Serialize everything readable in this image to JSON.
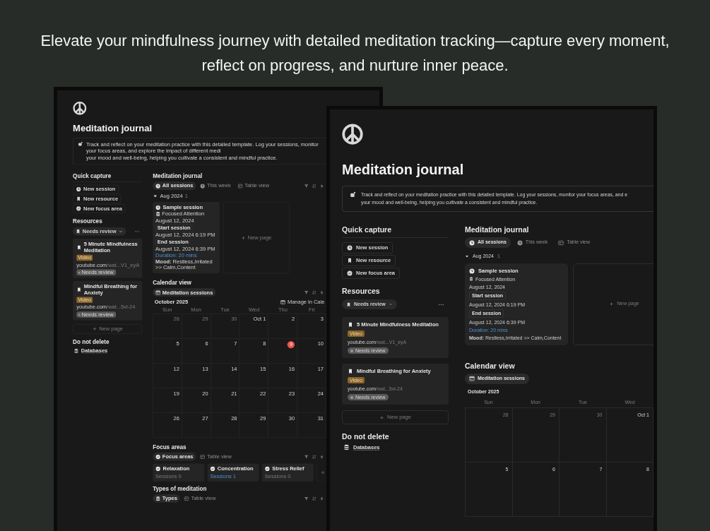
{
  "headline": "Elevate your mindfulness journey with detailed meditation tracking—capture every moment, reflect on progress, and nurture inner peace.",
  "screens": [
    {
      "toolbar_icons": true,
      "title": "Meditation journal",
      "callout_lines": [
        "Track and reflect on your meditation practice with this detailed template. Log your sessions, monitor your focus areas, and explore the impact of different medi",
        "your mood and well-being, helping you cultivate a consistent and mindful practice."
      ],
      "quick_capture": {
        "heading": "Quick capture",
        "buttons": [
          {
            "kind": "session",
            "label": "New session"
          },
          {
            "kind": "resource",
            "label": "New resource"
          },
          {
            "kind": "focus_area",
            "label": "New focus area"
          }
        ]
      },
      "resources": {
        "heading": "Resources",
        "filter": "Needs review",
        "cards": [
          {
            "title": "5 Minute Mindfulness Meditation",
            "tag": "Video",
            "url_host": "youtube.com",
            "url_path": "/wat...V1_eyA",
            "status": "Needs review"
          },
          {
            "title": "Mindful Breathing for Anxiety",
            "tag": "Video",
            "url_host": "youtube.com",
            "url_path": "/wat...5vl-24",
            "status": "Needs review"
          }
        ],
        "new_page": "New page"
      },
      "do_not_delete": {
        "heading": "Do not delete",
        "items": [
          "Databases"
        ]
      },
      "journal": {
        "heading": "Meditation journal",
        "tabs": [
          {
            "kind": "sessions",
            "label": "All sessions",
            "selected": true
          },
          {
            "kind": "sessions",
            "label": "This week",
            "selected": false
          },
          {
            "kind": "table",
            "label": "Table view",
            "selected": false
          }
        ],
        "group": {
          "label": "Aug 2024",
          "count": "1",
          "expanded": true
        },
        "card": {
          "title": "Sample session",
          "type": "Focused Attention",
          "date": "August 12, 2024",
          "start_label": "Start session",
          "start": "August 12, 2024 6:19 PM",
          "end_label": "End session",
          "end": "August 12, 2024 6:39 PM",
          "duration": "Duration: 20 mins",
          "mood": "**Mood:** Restless,Irritated >> Calm,Content"
        },
        "new_page": "New page"
      },
      "calendar": {
        "heading": "Calendar view",
        "tabs": [
          {
            "kind": "calendar",
            "label": "Meditation sessions",
            "selected": true
          }
        ],
        "month": "October 2025",
        "manage": "Manage in Cale",
        "weekdays": [
          "Sun",
          "Mon",
          "Tue",
          "Wed",
          "Thu",
          "Fri"
        ],
        "weeks": [
          [
            {
              "label": "28",
              "muted": true,
              "today": false
            },
            {
              "label": "29",
              "muted": true,
              "today": false
            },
            {
              "label": "30",
              "muted": true,
              "today": false
            },
            {
              "label": "Oct 1",
              "muted": false,
              "today": false
            },
            {
              "label": "2",
              "muted": false,
              "today": false
            },
            {
              "label": "3",
              "muted": false,
              "today": false
            }
          ],
          [
            {
              "label": "5",
              "muted": false,
              "today": false
            },
            {
              "label": "6",
              "muted": false,
              "today": false
            },
            {
              "label": "7",
              "muted": false,
              "today": false
            },
            {
              "label": "8",
              "muted": false,
              "today": false
            },
            {
              "label": "9",
              "muted": false,
              "today": true
            },
            {
              "label": "10",
              "muted": false,
              "today": false
            }
          ],
          [
            {
              "label": "12",
              "muted": false,
              "today": false
            },
            {
              "label": "13",
              "muted": false,
              "today": false
            },
            {
              "label": "14",
              "muted": false,
              "today": false
            },
            {
              "label": "15",
              "muted": false,
              "today": false
            },
            {
              "label": "16",
              "muted": false,
              "today": false
            },
            {
              "label": "17",
              "muted": false,
              "today": false
            }
          ],
          [
            {
              "label": "19",
              "muted": false,
              "today": false
            },
            {
              "label": "20",
              "muted": false,
              "today": false
            },
            {
              "label": "21",
              "muted": false,
              "today": false
            },
            {
              "label": "22",
              "muted": false,
              "today": false
            },
            {
              "label": "23",
              "muted": false,
              "today": false
            },
            {
              "label": "24",
              "muted": false,
              "today": false
            }
          ],
          [
            {
              "label": "26",
              "muted": false,
              "today": false
            },
            {
              "label": "27",
              "muted": false,
              "today": false
            },
            {
              "label": "28",
              "muted": false,
              "today": false
            },
            {
              "label": "29",
              "muted": false,
              "today": false
            },
            {
              "label": "30",
              "muted": false,
              "today": false
            },
            {
              "label": "31",
              "muted": false,
              "today": false
            }
          ]
        ]
      },
      "focus_areas": {
        "heading": "Focus areas",
        "tabs": [
          {
            "kind": "focus",
            "label": "Focus areas",
            "selected": true
          },
          {
            "kind": "table",
            "label": "Table view",
            "selected": false
          }
        ],
        "cards": [
          {
            "title": "Relaxation",
            "sessions": "Sessions 0",
            "linked": false
          },
          {
            "title": "Concentration",
            "sessions": "Sessions 1",
            "linked": true
          },
          {
            "title": "Stress Relief",
            "sessions": "Sessions 0",
            "linked": false
          }
        ]
      },
      "types": {
        "heading": "Types of meditation",
        "tabs": [
          {
            "kind": "types",
            "label": "Types",
            "selected": true
          },
          {
            "kind": "table",
            "label": "Table view",
            "selected": false
          }
        ]
      }
    },
    {
      "title": "Meditation journal",
      "callout_lines": [
        "Track and reflect on your meditation practice with this detailed template. Log your sessions, monitor your focus areas, and e",
        "your mood and well-being, helping you cultivate a consistent and mindful practice."
      ],
      "quick_capture": {
        "heading": "Quick capture",
        "buttons": [
          {
            "kind": "session",
            "label": "New session"
          },
          {
            "kind": "resource",
            "label": "New resource"
          },
          {
            "kind": "focus_area",
            "label": "New focus area"
          }
        ]
      },
      "resources": {
        "heading": "Resources",
        "filter": "Needs review",
        "cards": [
          {
            "title": "5 Minute Mindfulness Meditation",
            "tag": "Video",
            "url_host": "youtube.com",
            "url_path": "/wat...V1_eyA",
            "status": "Needs review"
          },
          {
            "title": "Mindful Breathing for Anxiety",
            "tag": "Video",
            "url_host": "youtube.com",
            "url_path": "/wat...5vl-24",
            "status": "Needs review"
          }
        ],
        "new_page": "New page"
      },
      "do_not_delete": {
        "heading": "Do not delete",
        "items": [
          "Databases"
        ]
      },
      "journal": {
        "heading": "Meditation journal",
        "tabs": [
          {
            "kind": "sessions",
            "label": "All sessions",
            "selected": true
          },
          {
            "kind": "sessions",
            "label": "This week",
            "selected": false
          },
          {
            "kind": "table",
            "label": "Table view",
            "selected": false
          }
        ],
        "group": {
          "label": "Aug 2024",
          "count": "1",
          "expanded": true
        },
        "card": {
          "title": "Sample session",
          "type": "Focused Attention",
          "date": "August 12, 2024",
          "start_label": "Start session",
          "start": "August 12, 2024 6:19 PM",
          "end_label": "End session",
          "end": "August 12, 2024 6:39 PM",
          "duration": "Duration: 20 mins",
          "mood": "**Mood:** Restless,Irritated >> Calm,Content"
        },
        "new_page": "New page"
      },
      "calendar": {
        "heading": "Calendar view",
        "tabs": [
          {
            "kind": "calendar",
            "label": "Meditation sessions",
            "selected": true
          }
        ],
        "month": "October 2025",
        "weekdays": [
          "Sun",
          "Mon",
          "Tue",
          "Wed"
        ],
        "weeks": [
          [
            {
              "label": "28",
              "muted": true,
              "today": false
            },
            {
              "label": "29",
              "muted": true,
              "today": false
            },
            {
              "label": "30",
              "muted": true,
              "today": false
            },
            {
              "label": "Oct 1",
              "muted": false,
              "today": false
            }
          ],
          [
            {
              "label": "5",
              "muted": false,
              "today": false
            },
            {
              "label": "6",
              "muted": false,
              "today": false
            },
            {
              "label": "7",
              "muted": false,
              "today": false
            },
            {
              "label": "8",
              "muted": false,
              "today": false
            }
          ]
        ]
      }
    }
  ]
}
